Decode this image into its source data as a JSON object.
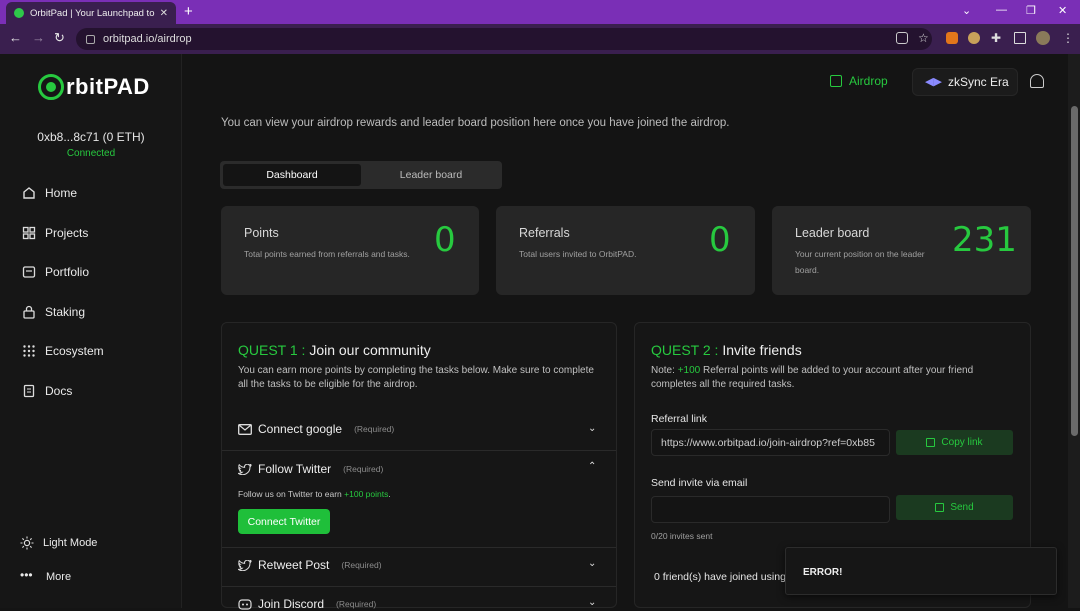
{
  "browser": {
    "tab_title": "OrbitPad | Your Launchpad to Su",
    "url": "orbitpad.io/airdrop",
    "new_tab": "+",
    "tab_close": "✕"
  },
  "sidebar": {
    "logo": "rbitPAD",
    "wallet": "0xb8...8c71 (0 ETH)",
    "status": "Connected",
    "items": [
      {
        "label": "Home"
      },
      {
        "label": "Projects"
      },
      {
        "label": "Portfolio"
      },
      {
        "label": "Staking"
      },
      {
        "label": "Ecosystem"
      },
      {
        "label": "Docs"
      }
    ],
    "light_mode": "Light Mode",
    "more": "More"
  },
  "header": {
    "airdrop": "Airdrop",
    "network": "zkSync Era"
  },
  "main": {
    "intro": "You can view your airdrop rewards and leader board position here once you have joined the airdrop.",
    "tabs": [
      "Dashboard",
      "Leader board"
    ],
    "stats": [
      {
        "title": "Points",
        "desc": "Total points earned from referrals and tasks.",
        "value": "0"
      },
      {
        "title": "Referrals",
        "desc": "Total users invited to OrbitPAD.",
        "value": "0"
      },
      {
        "title": "Leader board",
        "desc": "Your current position on the leader board.",
        "value": "231"
      }
    ]
  },
  "quest1": {
    "prefix": "QUEST 1 :",
    "title": " Join our community",
    "desc": "You can earn more points by completing the tasks below. Make sure to complete all the tasks to be eligible for the airdrop.",
    "tasks": [
      {
        "label": "Connect google",
        "req": "(Required)"
      },
      {
        "label": "Follow Twitter",
        "req": "(Required)"
      },
      {
        "label": "Retweet Post",
        "req": "(Required)"
      },
      {
        "label": "Join Discord",
        "req": "(Required)"
      }
    ],
    "follow_note_pre": "Follow us on Twitter to earn ",
    "follow_note_pts": "+100 points",
    "follow_note_post": ".",
    "connect_twitter": "Connect Twitter"
  },
  "quest2": {
    "prefix": "QUEST 2 :",
    "title": " Invite friends",
    "note_pre": "Note: ",
    "note_pts": "+100",
    "note_post": " Referral points will be added to your account after your friend completes all the required tasks.",
    "referral_label": "Referral link",
    "referral_value": "https://www.orbitpad.io/join-airdrop?ref=0xb85",
    "copy_link": "Copy link",
    "email_label": "Send invite via email",
    "email_value": "",
    "send": "Send",
    "invites_sent": "0/20 invites sent",
    "friends_joined": "0 friend(s) have joined using"
  },
  "toast": {
    "text": "ERROR!"
  },
  "colors": {
    "accent": "#27c93f",
    "browser_frame": "#7a2fb6",
    "bg": "#141414",
    "card": "#262626"
  }
}
